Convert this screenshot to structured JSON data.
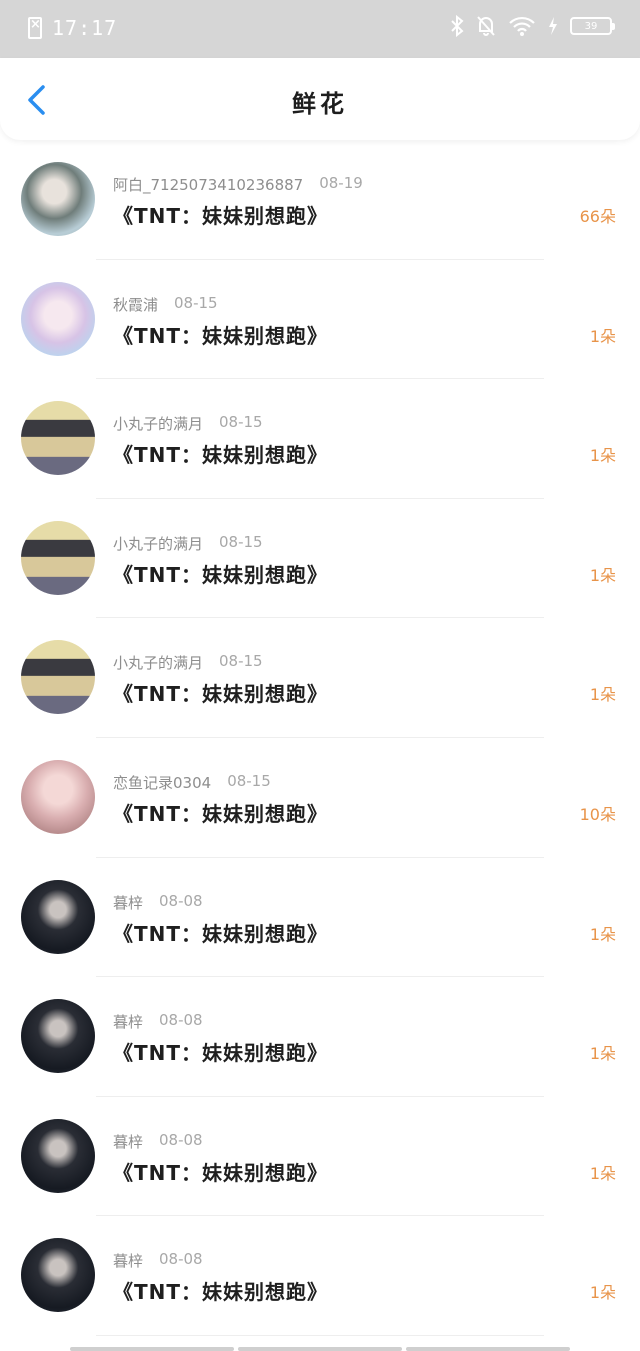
{
  "status_bar": {
    "time": "17:17",
    "battery": "39"
  },
  "nav": {
    "title": "鲜花"
  },
  "items": [
    {
      "user": "阿白_7125073410236887",
      "date": "08-19",
      "book": "《TNT：妹妹别想跑》",
      "count": "66朵",
      "avatar": "av-a"
    },
    {
      "user": "秋霞浦",
      "date": "08-15",
      "book": "《TNT：妹妹别想跑》",
      "count": "1朵",
      "avatar": "av-b"
    },
    {
      "user": "小丸子的满月",
      "date": "08-15",
      "book": "《TNT：妹妹别想跑》",
      "count": "1朵",
      "avatar": "av-c"
    },
    {
      "user": "小丸子的满月",
      "date": "08-15",
      "book": "《TNT：妹妹别想跑》",
      "count": "1朵",
      "avatar": "av-c"
    },
    {
      "user": "小丸子的满月",
      "date": "08-15",
      "book": "《TNT：妹妹别想跑》",
      "count": "1朵",
      "avatar": "av-c"
    },
    {
      "user": "恋鱼记录0304",
      "date": "08-15",
      "book": "《TNT：妹妹别想跑》",
      "count": "10朵",
      "avatar": "av-d"
    },
    {
      "user": "暮梓",
      "date": "08-08",
      "book": "《TNT：妹妹别想跑》",
      "count": "1朵",
      "avatar": "av-e"
    },
    {
      "user": "暮梓",
      "date": "08-08",
      "book": "《TNT：妹妹别想跑》",
      "count": "1朵",
      "avatar": "av-e"
    },
    {
      "user": "暮梓",
      "date": "08-08",
      "book": "《TNT：妹妹别想跑》",
      "count": "1朵",
      "avatar": "av-e"
    },
    {
      "user": "暮梓",
      "date": "08-08",
      "book": "《TNT：妹妹别想跑》",
      "count": "1朵",
      "avatar": "av-e"
    }
  ],
  "colors": {
    "accent": "#e8944a",
    "back": "#2a8ef0"
  }
}
